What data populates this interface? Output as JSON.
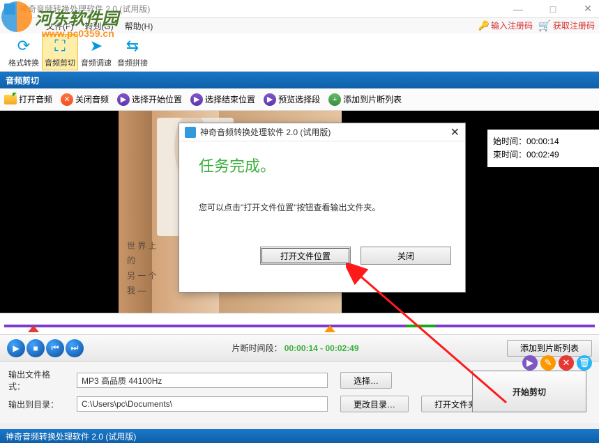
{
  "window": {
    "title": "神奇音频转换处理软件 2.0 (试用版)",
    "controls": {
      "min": "—",
      "max": "□",
      "close": "✕"
    }
  },
  "watermark": {
    "site": "河东软件园",
    "url": "www.pc0359.cn"
  },
  "menu": {
    "file": "文件(F)",
    "goto": "转到(G)",
    "help": "帮助(H)"
  },
  "reg": {
    "enter_code": "输入注册码",
    "get_code": "获取注册码"
  },
  "tools": {
    "convert": "格式转换",
    "cut": "音频剪切",
    "speed": "音频调速",
    "splice": "音频拼接"
  },
  "section_title": "音频剪切",
  "actions": {
    "open": "打开音频",
    "close": "关闭音频",
    "sel_start": "选择开始位置",
    "sel_end": "选择结束位置",
    "preview": "预览选择段",
    "add_list": "添加到片断列表"
  },
  "side": {
    "start_label": "始时间：",
    "start_val": "00:00:14",
    "end_label": "束时间：",
    "end_val": "00:02:49"
  },
  "album": {
    "l1": "世 界  上",
    "l2": "的",
    "l3": "另 一 个",
    "l4": "我  —"
  },
  "playbar": {
    "range_label": "片断时间段",
    "range_val": "00:00:14 - 00:02:49",
    "add_btn": "添加到片断列表"
  },
  "settings": {
    "fmt_label": "输出文件格式：",
    "fmt_value": "MP3 高品质 44100Hz",
    "fmt_btn": "选择…",
    "dir_label": "输出到目录：",
    "dir_value": "C:\\Users\\pc\\Documents\\",
    "dir_btn": "更改目录…",
    "open_btn": "打开文件夹"
  },
  "big_btn": "开始剪切",
  "statusbar": "神奇音频转换处理软件 2.0 (试用版)",
  "dialog": {
    "title": "神奇音频转换处理软件 2.0 (试用版)",
    "heading": "任务完成。",
    "body": "您可以点击\"打开文件位置\"按钮查看输出文件夹。",
    "ok": "打开文件位置",
    "close": "关闭"
  }
}
